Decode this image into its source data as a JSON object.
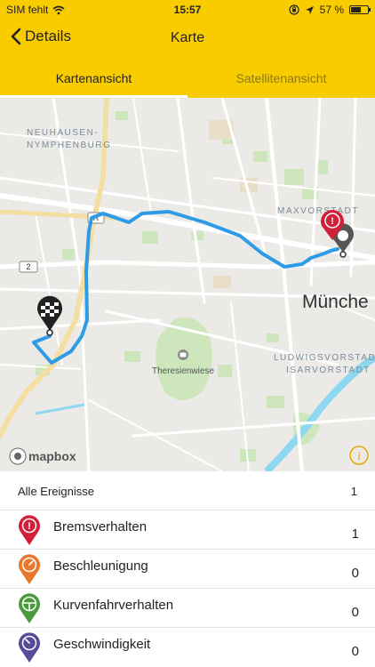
{
  "status_bar": {
    "carrier": "SIM fehlt",
    "time": "15:57",
    "battery": "57 %",
    "battery_level": 0.57
  },
  "nav": {
    "back_label": "Details",
    "title": "Karte"
  },
  "tabs": [
    {
      "label": "Kartenansicht",
      "active": true
    },
    {
      "label": "Satellitenansicht",
      "active": false
    }
  ],
  "map": {
    "labels": {
      "neuhausen_1": "NEUHAUSEN-",
      "neuhausen_2": "NYMPHENBURG",
      "maxvorstadt": "MAXVORSTADT",
      "muenchen": "Münche",
      "theresienwiese": "Theresienwiese",
      "ludwigsvorstadt_1": "LUDWIGSVORSTADT",
      "ludwigsvorstadt_2": "ISARVORSTADT",
      "shield_r": "R",
      "shield_2": "2",
      "mapbox": "mapbox",
      "info": "i"
    },
    "route_color": "#2e9be6",
    "colors": {
      "brake": "#d3203a",
      "accel": "#e8792c",
      "curve": "#4c9b3a",
      "speed": "#5a4a9a"
    }
  },
  "events": {
    "all_label": "Alle Ereignisse",
    "all_count": "1",
    "items": [
      {
        "label": "Bremsverhalten",
        "count": "1",
        "icon": "brake-icon",
        "color": "#d3203a"
      },
      {
        "label": "Beschleunigung",
        "count": "0",
        "icon": "accelerometer-icon",
        "color": "#e8792c"
      },
      {
        "label": "Kurvenfahrverhalten",
        "count": "0",
        "icon": "steering-wheel-icon",
        "color": "#4c9b3a"
      },
      {
        "label": "Geschwindigkeit",
        "count": "0",
        "icon": "speedometer-icon",
        "color": "#5a4a9a"
      }
    ]
  }
}
